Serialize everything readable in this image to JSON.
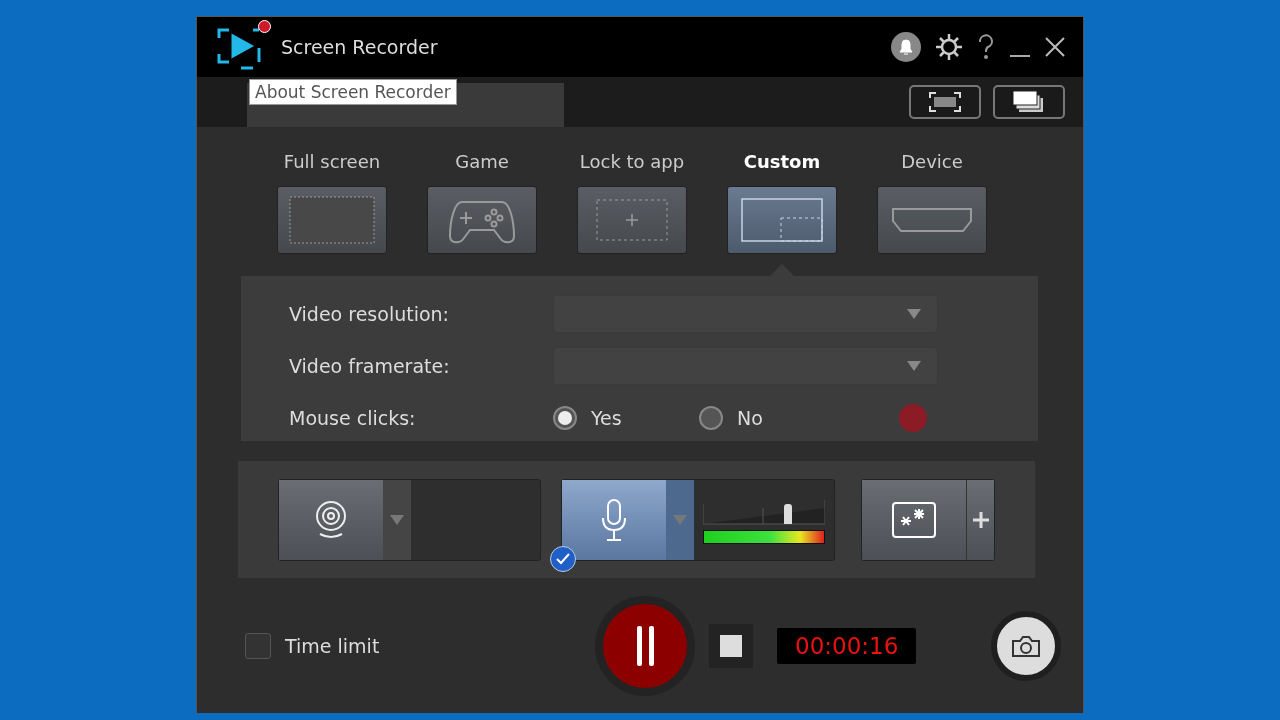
{
  "window": {
    "title": "Screen Recorder",
    "tooltip": "About Screen Recorder",
    "notification": true
  },
  "view_buttons": [
    {
      "kind": "region"
    },
    {
      "kind": "windows"
    }
  ],
  "modes": [
    {
      "label": "Full screen",
      "kind": "full",
      "selected": false
    },
    {
      "label": "Game",
      "kind": "game",
      "selected": false
    },
    {
      "label": "Lock to app",
      "kind": "app",
      "selected": false
    },
    {
      "label": "Custom",
      "kind": "custom",
      "selected": true
    },
    {
      "label": "Device",
      "kind": "device",
      "selected": false
    }
  ],
  "settings": {
    "resolution_label": "Video resolution:",
    "framerate_label": "Video framerate:",
    "mouse_label": "Mouse clicks:",
    "mouse_options": [
      {
        "label": "Yes",
        "selected": true
      },
      {
        "label": "No",
        "selected": false
      }
    ]
  },
  "devices": [
    {
      "kind": "webcam",
      "selected": false
    },
    {
      "kind": "microphone",
      "selected": true,
      "level": 0.7
    },
    {
      "kind": "effects",
      "selected": false
    }
  ],
  "controls": {
    "time_limit": {
      "label": "Time limit",
      "checked": false
    },
    "recording": true,
    "timer": "00:00:16"
  }
}
